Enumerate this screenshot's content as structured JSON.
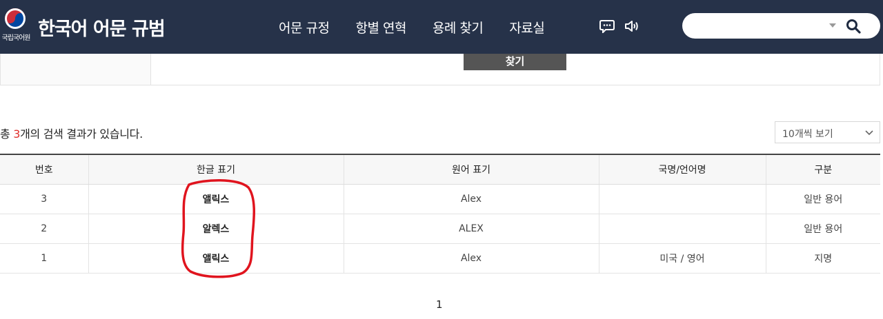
{
  "header": {
    "org_name": "국립국어원",
    "site_title": "한국어 어문 규범",
    "nav": [
      "어문 규정",
      "항별 연혁",
      "용례 찾기",
      "자료실"
    ],
    "icons": [
      "chat-icon",
      "speaker-icon"
    ],
    "search": {
      "value": "",
      "placeholder": ""
    }
  },
  "form": {
    "find_button": "찾기"
  },
  "results": {
    "summary_prefix": "총 ",
    "count": "3",
    "summary_suffix": "개의 검색 결과가 있습니다.",
    "page_size": "10개씩 보기",
    "columns": [
      "번호",
      "한글 표기",
      "원어 표기",
      "국명/언어명",
      "구분"
    ],
    "rows": [
      {
        "no": "3",
        "hangul": "앨릭스",
        "original": "Alex",
        "country": "",
        "category": "일반 용어"
      },
      {
        "no": "2",
        "hangul": "알렉스",
        "original": "ALEX",
        "country": "",
        "category": "일반 용어"
      },
      {
        "no": "1",
        "hangul": "앨릭스",
        "original": "Alex",
        "country": "미국 / 영어",
        "category": "지명"
      }
    ]
  },
  "annotation": {
    "color": "#e0141e"
  },
  "pagination": {
    "current": "1"
  },
  "colors": {
    "header_bg": "#263249",
    "accent": "#e0302c"
  }
}
